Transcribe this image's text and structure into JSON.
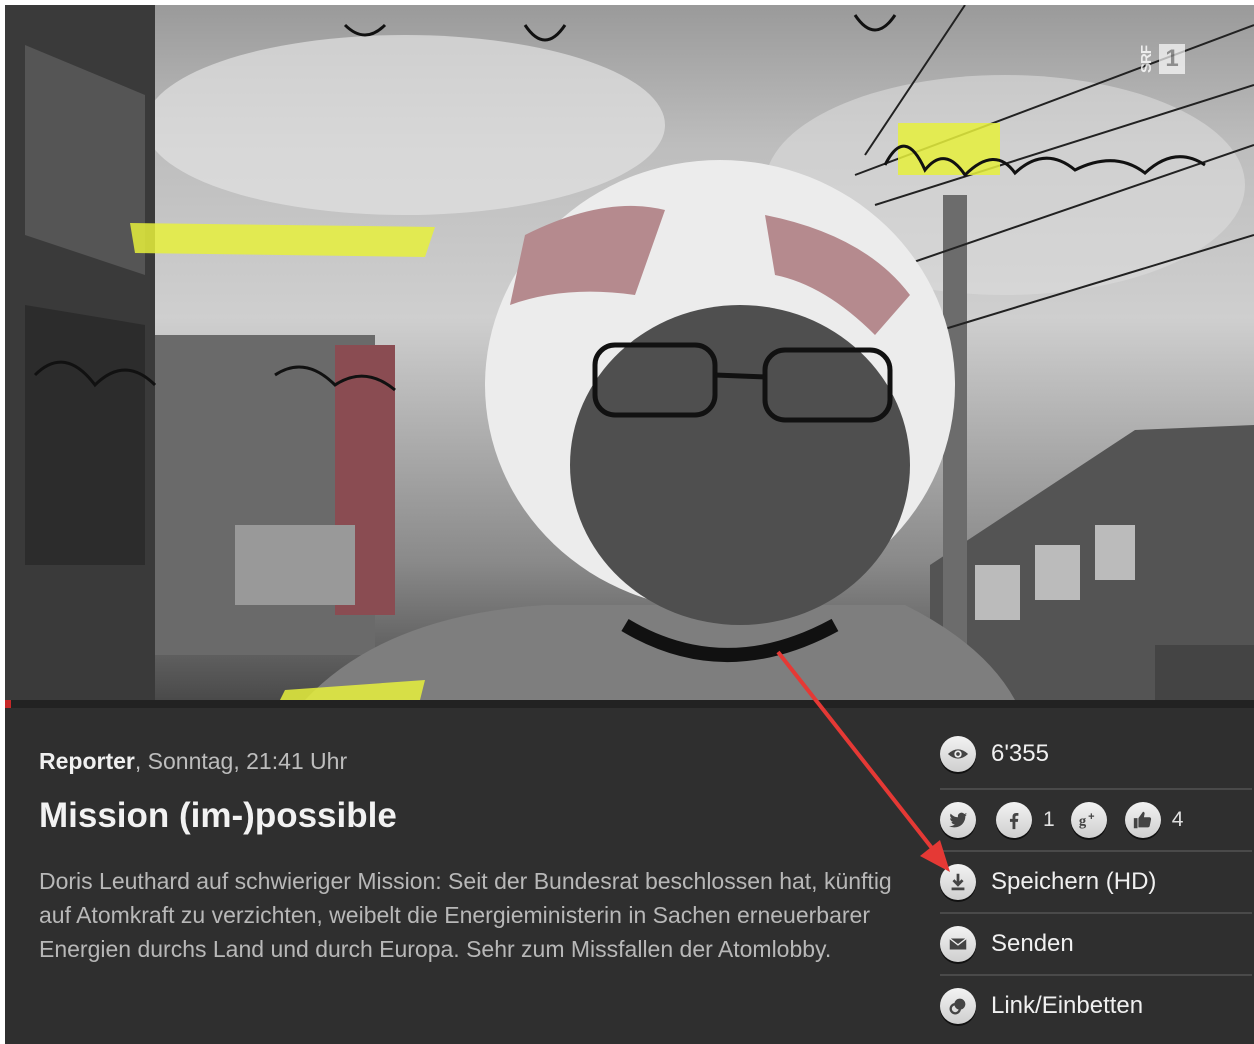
{
  "video": {
    "watermark_channel": "SRF",
    "watermark_number": "1",
    "progress_fraction": 0.005
  },
  "episode": {
    "show": "Reporter",
    "airtime": ", Sonntag, 21:41 Uhr",
    "title": "Mission (im-)possible",
    "description": "Doris Leuthard auf schwieriger Mission: Seit der Bundesrat beschlossen hat, künftig auf Atomkraft zu verzichten, weibelt die Energieministerin in Sachen erneuerbarer Energien durchs Land und durch Europa. Sehr zum Missfallen der Atomlobby."
  },
  "stats": {
    "views": "6'355",
    "facebook_count": "1",
    "likes_count": "4"
  },
  "actions": {
    "save_label": "Speichern (HD)",
    "send_label": "Senden",
    "embed_label": "Link/Einbetten"
  },
  "icons": {
    "views": "eye-icon",
    "twitter": "twitter-icon",
    "facebook": "facebook-icon",
    "googleplus": "google-plus-icon",
    "like": "thumbs-up-icon",
    "save": "download-icon",
    "send": "envelope-icon",
    "embed": "link-icon"
  },
  "colors": {
    "panel_bg": "#2f2f2f",
    "progress": "#c62828",
    "annotation_arrow": "#e53935",
    "highlighter": "#e6f03c"
  }
}
